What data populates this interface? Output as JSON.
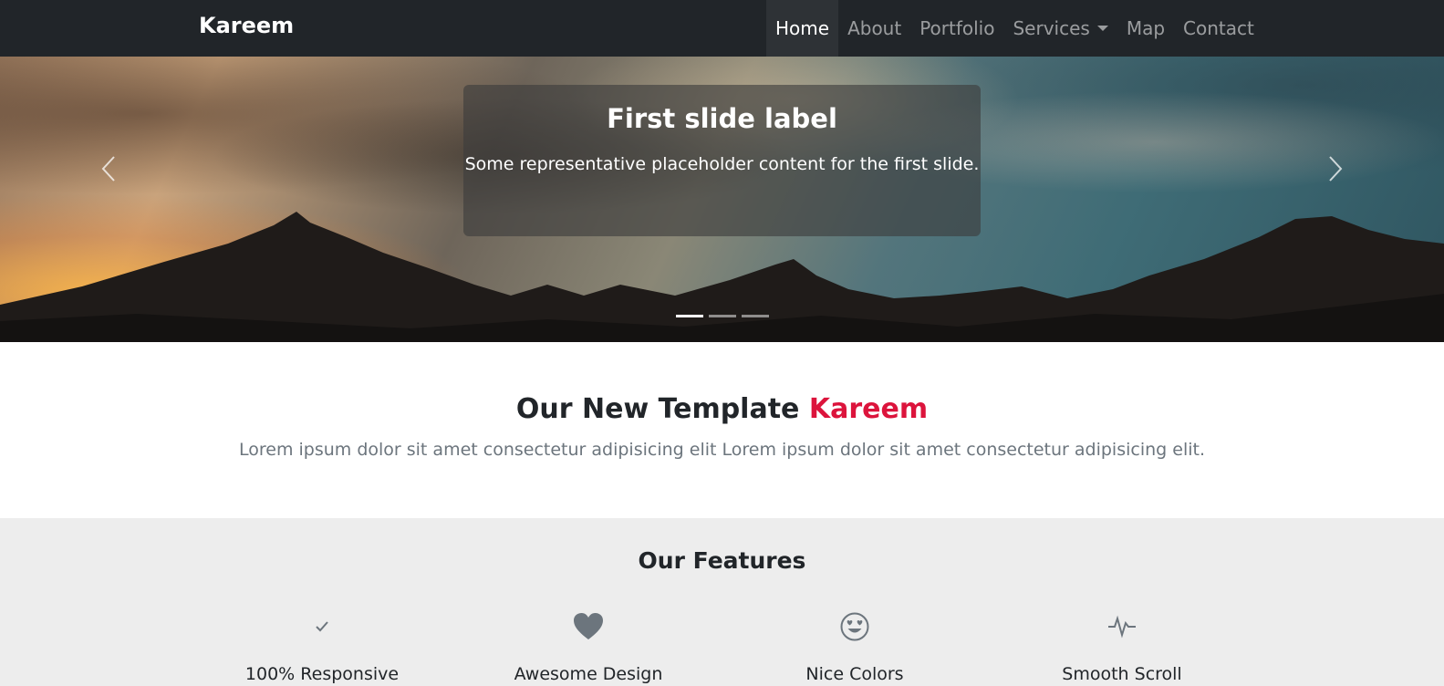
{
  "navbar": {
    "brand": "Kareem",
    "links": [
      {
        "label": "Home",
        "active": true
      },
      {
        "label": "About"
      },
      {
        "label": "Portfolio"
      },
      {
        "label": "Services",
        "dropdown": true
      },
      {
        "label": "Map"
      },
      {
        "label": "Contact"
      }
    ]
  },
  "carousel": {
    "caption_title": "First slide label",
    "caption_text": "Some representative placeholder content for the first slide.",
    "prev_icon": "chevron-left-icon",
    "next_icon": "chevron-right-icon",
    "slide_count": 3,
    "active_index": 0
  },
  "intro": {
    "title_prefix": "Our New Template ",
    "title_accent": "Kareem",
    "text": "Lorem ipsum dolor sit amet consectetur adipisicing elit Lorem ipsum dolor sit amet consectetur adipisicing elit.",
    "accent_color": "#dc143c"
  },
  "features": {
    "title": "Our Features",
    "items": [
      {
        "icon": "check-icon",
        "label": "100% Responsive"
      },
      {
        "icon": "heart-icon",
        "label": "Awesome Design"
      },
      {
        "icon": "smile-heart-eyes-icon",
        "label": "Nice Colors"
      },
      {
        "icon": "activity-icon",
        "label": "Smooth Scroll"
      }
    ]
  }
}
